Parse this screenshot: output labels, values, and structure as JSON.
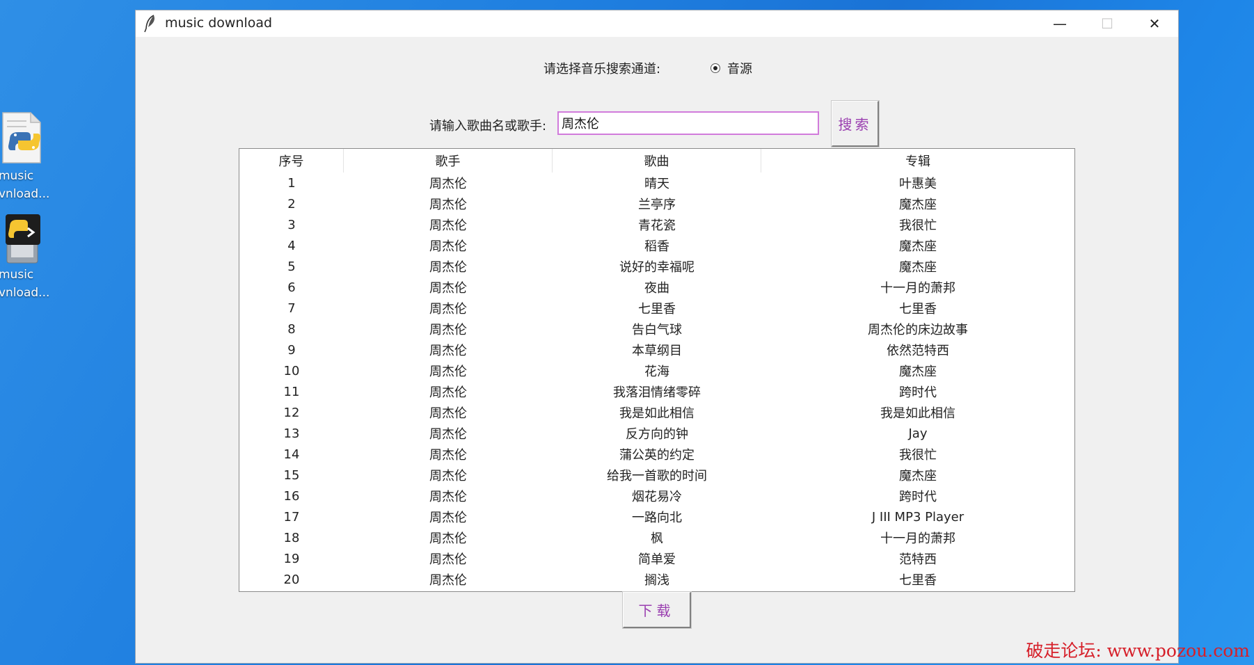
{
  "desktop": {
    "icons": [
      {
        "label_line1": "music",
        "label_line2": "vnload..."
      },
      {
        "label_line1": "music",
        "label_line2": "vnload..."
      }
    ]
  },
  "window": {
    "title": "music download",
    "minimize_glyph": "—",
    "maximize_glyph": "☐",
    "close_glyph": "✕"
  },
  "channel": {
    "label": "请选择音乐搜索通道:",
    "option": "音源"
  },
  "search": {
    "label": "请输入歌曲名或歌手:",
    "value": "周杰伦",
    "button_label": "搜索"
  },
  "table": {
    "columns": [
      "序号",
      "歌手",
      "歌曲",
      "专辑"
    ],
    "rows": [
      [
        "1",
        "周杰伦",
        "晴天",
        "叶惠美"
      ],
      [
        "2",
        "周杰伦",
        "兰亭序",
        "魔杰座"
      ],
      [
        "3",
        "周杰伦",
        "青花瓷",
        "我很忙"
      ],
      [
        "4",
        "周杰伦",
        "稻香",
        "魔杰座"
      ],
      [
        "5",
        "周杰伦",
        "说好的幸福呢",
        "魔杰座"
      ],
      [
        "6",
        "周杰伦",
        "夜曲",
        "十一月的萧邦"
      ],
      [
        "7",
        "周杰伦",
        "七里香",
        "七里香"
      ],
      [
        "8",
        "周杰伦",
        "告白气球",
        "周杰伦的床边故事"
      ],
      [
        "9",
        "周杰伦",
        "本草纲目",
        "依然范特西"
      ],
      [
        "10",
        "周杰伦",
        "花海",
        "魔杰座"
      ],
      [
        "11",
        "周杰伦",
        "我落泪情绪零碎",
        "跨时代"
      ],
      [
        "12",
        "周杰伦",
        "我是如此相信",
        "我是如此相信"
      ],
      [
        "13",
        "周杰伦",
        "反方向的钟",
        "Jay"
      ],
      [
        "14",
        "周杰伦",
        "蒲公英的约定",
        "我很忙"
      ],
      [
        "15",
        "周杰伦",
        "给我一首歌的时间",
        "魔杰座"
      ],
      [
        "16",
        "周杰伦",
        "烟花易冷",
        "跨时代"
      ],
      [
        "17",
        "周杰伦",
        "一路向北",
        "J III MP3 Player"
      ],
      [
        "18",
        "周杰伦",
        "枫",
        "十一月的萧邦"
      ],
      [
        "19",
        "周杰伦",
        "简单爱",
        "范特西"
      ],
      [
        "20",
        "周杰伦",
        "搁浅",
        "七里香"
      ]
    ]
  },
  "download": {
    "button_label": "下载"
  },
  "watermark": {
    "text": "破走论坛: www.pozou.com"
  }
}
